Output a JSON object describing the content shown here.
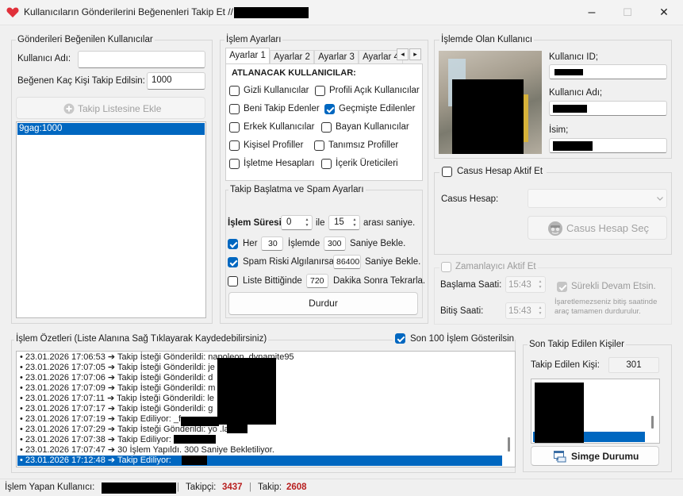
{
  "window": {
    "title": "Kullanıcıların Gönderilerini Beğenenleri Takip Et //",
    "minimize_glyph": "–",
    "maximize_glyph": "☐",
    "close_glyph": "✕",
    "app_icon": "heart-icon"
  },
  "left_panel": {
    "group_title": "Gönderileri Beğenilen Kullanıcılar",
    "username_label": "Kullanıcı Adı:",
    "username_value": "",
    "follow_count_label": "Beğenen Kaç Kişi Takip Edilsin:",
    "follow_count_value": "1000",
    "add_button": "Takip Listesine Ekle",
    "list_items": [
      "9gag:1000"
    ]
  },
  "process_settings": {
    "group_title": "İşlem Ayarları",
    "tabs": [
      "Ayarlar 1",
      "Ayarlar 2",
      "Ayarlar 3",
      "Ayarlar 4"
    ],
    "tab_prev": "◂",
    "tab_next": "▸",
    "skip_header": "ATLANACAK KULLANICILAR:",
    "checkboxes": [
      {
        "label": "Gizli Kullanıcılar",
        "checked": false
      },
      {
        "label": "Profili Açık Kullanıcılar",
        "checked": false
      },
      {
        "label": "Beni Takip Edenler",
        "checked": false
      },
      {
        "label": "Geçmişte Edilenler",
        "checked": true
      },
      {
        "label": "Erkek Kullanıcılar",
        "checked": false
      },
      {
        "label": "Bayan Kullanıcılar",
        "checked": false
      },
      {
        "label": "Kişisel Profiller",
        "checked": false
      },
      {
        "label": "Tanımsız Profiller",
        "checked": false
      },
      {
        "label": "İşletme Hesapları",
        "checked": false
      },
      {
        "label": "İçerik Üreticileri",
        "checked": false
      }
    ],
    "spam_group_title": "Takip Başlatma ve Spam Ayarları",
    "duration_label": "İşlem Süresi:",
    "duration_min": "0",
    "duration_and": "ile",
    "duration_max": "15",
    "duration_suffix": "arası saniye.",
    "every_label": "Her",
    "every_value": "30",
    "every_mid": "İşlemde",
    "every_wait": "300",
    "every_suffix": "Saniye Bekle.",
    "spam_label": "Spam Riski Algılanırsa",
    "spam_value": "86400",
    "spam_suffix": "Saniye Bekle.",
    "list_end_label": "Liste Bittiğinde",
    "list_end_value": "720",
    "list_end_suffix": "Dakika Sonra Tekrarla.",
    "stop_button": "Durdur"
  },
  "current_user": {
    "group_title": "İşlemde Olan Kullanıcı",
    "id_label": "Kullanıcı ID;",
    "username_label": "Kullanıcı Adı;",
    "name_label": "İsim;"
  },
  "spy_account": {
    "checkbox_label": "Casus Hesap Aktif Et",
    "account_label": "Casus Hesap:",
    "select_button": "Casus Hesap Seç"
  },
  "timer": {
    "checkbox_label": "Zamanlayıcı Aktif Et",
    "start_label": "Başlama Saati:",
    "start_value": "15:43",
    "end_label": "Bitiş Saati:",
    "end_value": "15:43",
    "continuous_label": "Sürekli Devam Etsin.",
    "note_line1": "İşaretlemezseniz bitiş saatinde",
    "note_line2": "araç tamamen durdurulur."
  },
  "log": {
    "group_title": "İşlem Özetleri (Liste Alanına Sağ Tıklayarak Kaydedebilirsiniz)",
    "last100_label": "Son 100 İşlem Gösterilsin",
    "lines": [
      "• 23.01.2026 17:06:53 ➔ Takip İsteği Gönderildi: napoleon_dynamite95",
      "• 23.01.2026 17:07:05 ➔ Takip İsteği Gönderildi: je",
      "• 23.01.2026 17:07:06 ➔ Takip İsteği Gönderildi: d",
      "• 23.01.2026 17:07:09 ➔ Takip İsteği Gönderildi: m",
      "• 23.01.2026 17:07:11 ➔ Takip İsteği Gönderildi: le",
      "• 23.01.2026 17:07:17 ➔ Takip İsteği Gönderildi: g",
      "• 23.01.2026 17:07:19 ➔ Takip Ediliyor: _f",
      "• 23.01.2026 17:07:29 ➔ Takip İsteği Gönderildi: yo       .lau",
      "• 23.01.2026 17:07:38 ➔ Takip Ediliyor:              t",
      "• 23.01.2026 17:07:47 ➔ 30 İşlem Yapıldı. 300 Saniye Bekletiliyor.",
      "• 23.01.2026 17:12:48 ➔ Takip Ediliyor:"
    ],
    "selected_index": 10
  },
  "last_followed": {
    "group_title": "Son Takip Edilen Kişiler",
    "followed_label": "Takip Edilen Kişi:",
    "followed_count": "301",
    "minimize_button": "Simge Durumu"
  },
  "status_bar": {
    "user_label": "İşlem Yapan Kullanıcı:",
    "sep": "|",
    "followers_label": "Takipçi:",
    "followers_value": "3437",
    "following_label": "Takip:",
    "following_value": "2608"
  },
  "colors": {
    "accent": "#0067c0",
    "stat_red": "#b81f1f"
  }
}
